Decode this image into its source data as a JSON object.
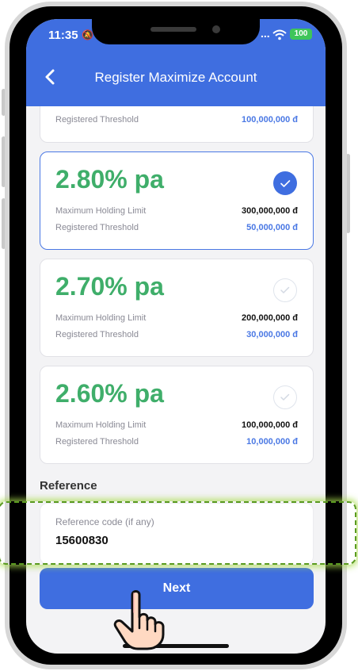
{
  "status_bar": {
    "time": "11:35",
    "dots": "...",
    "battery": "100"
  },
  "header": {
    "title": "Register Maximize Account"
  },
  "partial_card": {
    "label": "Registered Threshold",
    "value": "100,000,000 đ"
  },
  "plans": [
    {
      "rate": "2.80% pa",
      "limit_label": "Maximum Holding Limit",
      "limit_value": "300,000,000 đ",
      "threshold_label": "Registered Threshold",
      "threshold_value": "50,000,000 đ",
      "selected": true
    },
    {
      "rate": "2.70% pa",
      "limit_label": "Maximum Holding Limit",
      "limit_value": "200,000,000 đ",
      "threshold_label": "Registered Threshold",
      "threshold_value": "30,000,000 đ",
      "selected": false
    },
    {
      "rate": "2.60% pa",
      "limit_label": "Maximum Holding Limit",
      "limit_value": "100,000,000 đ",
      "threshold_label": "Registered Threshold",
      "threshold_value": "10,000,000 đ",
      "selected": false
    }
  ],
  "reference": {
    "section_title": "Reference",
    "field_label": "Reference code (if any)",
    "field_value": "15600830"
  },
  "next_button": {
    "label": "Next"
  },
  "colors": {
    "primary": "#3f6ee0",
    "rate_green": "#3fae6a",
    "highlight": "#5a9a20"
  },
  "icons": {
    "back": "chevron-left-icon",
    "check": "check-circle-icon",
    "hand": "tap-hand-icon"
  }
}
